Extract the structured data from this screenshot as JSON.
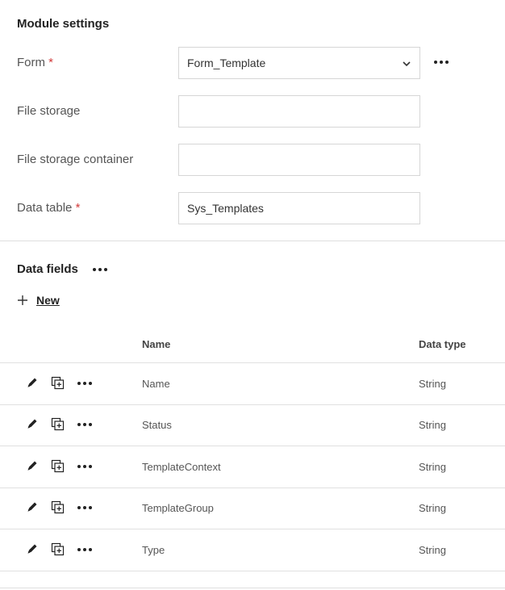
{
  "module_settings": {
    "title": "Module settings",
    "form_label": "Form",
    "required_mark": "*",
    "form_value": "Form_Template",
    "file_storage_label": "File storage",
    "file_storage_value": "",
    "file_storage_container_label": "File storage container",
    "file_storage_container_value": "",
    "data_table_label": "Data table",
    "data_table_value": "Sys_Templates"
  },
  "data_fields": {
    "title": "Data fields",
    "new_label": "New",
    "columns": {
      "name": "Name",
      "data_type": "Data type"
    },
    "rows": [
      {
        "name": "Name",
        "type": "String"
      },
      {
        "name": "Status",
        "type": "String"
      },
      {
        "name": "TemplateContext",
        "type": "String"
      },
      {
        "name": "TemplateGroup",
        "type": "String"
      },
      {
        "name": "Type",
        "type": "String"
      }
    ]
  },
  "icons": {
    "more": "more-dots-icon",
    "chevron": "chevron-down-icon",
    "plus": "plus-icon",
    "edit": "pencil-icon",
    "duplicate": "duplicate-icon"
  }
}
